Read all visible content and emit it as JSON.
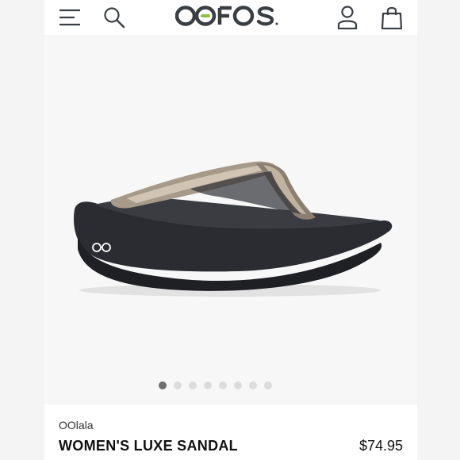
{
  "header": {
    "brand": "OOFOS",
    "icons": [
      "menu-icon",
      "search-icon",
      "account-icon",
      "shopping-bag-icon"
    ]
  },
  "gallery": {
    "slide_count": 8,
    "active_slide": 1,
    "image": "sandal-product-photo"
  },
  "product": {
    "collection": "OOlala",
    "name": "WOMEN'S LUXE SANDAL",
    "price": "$74.95"
  },
  "colors": {
    "brand_dark": "#3a3f44",
    "brand_green": "#8cc63f",
    "dot_active": "#6f6f6f",
    "dot_inactive": "#dcdcdc"
  }
}
